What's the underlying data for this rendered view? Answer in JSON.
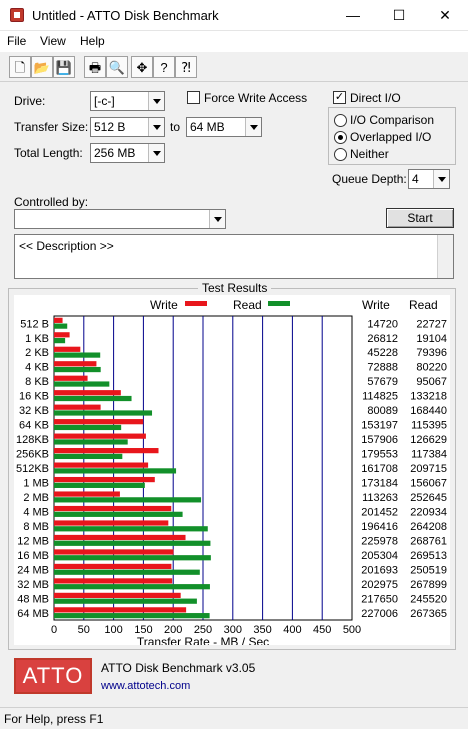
{
  "window": {
    "title": "Untitled - ATTO Disk Benchmark",
    "min_glyph": "—",
    "max_glyph": "☐",
    "close_glyph": "✕"
  },
  "menu": [
    "File",
    "View",
    "Help"
  ],
  "toolbar": {
    "icons": [
      "new-icon",
      "open-icon",
      "save-icon",
      "print-icon",
      "print-preview-icon",
      "move-icon",
      "help-icon",
      "context-help-icon"
    ],
    "glyphs": [
      "🗋",
      "📂",
      "💾",
      "🖶",
      "🔍",
      "✥",
      "?",
      "⁈"
    ]
  },
  "settings": {
    "drive_label": "Drive:",
    "drive_value": "[-c-]",
    "transfer_size_label": "Transfer Size:",
    "transfer_from": "512 B",
    "to_label": "to",
    "transfer_to": "64 MB",
    "total_length_label": "Total Length:",
    "total_length_value": "256 MB",
    "force_write_label": "Force Write Access",
    "force_write_checked": false,
    "direct_io_label": "Direct I/O",
    "direct_io_checked": true,
    "direct_io_mark": "✓",
    "io_comparison_label": "I/O Comparison",
    "overlapped_io_label": "Overlapped I/O",
    "neither_label": "Neither",
    "selected_io_mode": "Overlapped I/O",
    "queue_depth_label": "Queue Depth:",
    "queue_depth_value": "4",
    "controlled_by_label": "Controlled by:",
    "controlled_by_value": "",
    "start_label": "Start",
    "description": "<< Description >>"
  },
  "results": {
    "title": "Test Results",
    "write_legend": "Write",
    "read_legend": "Read",
    "write_header": "Write",
    "read_header": "Read"
  },
  "chart_data": {
    "type": "bar",
    "orientation": "horizontal",
    "categories": [
      "512 B",
      "1 KB",
      "2 KB",
      "4 KB",
      "8 KB",
      "16 KB",
      "32 KB",
      "64 KB",
      "128KB",
      "256KB",
      "512KB",
      "1 MB",
      "2 MB",
      "4 MB",
      "8 MB",
      "12 MB",
      "16 MB",
      "24 MB",
      "32 MB",
      "48 MB",
      "64 MB"
    ],
    "series": [
      {
        "name": "Write",
        "color": "#e8161c",
        "values": [
          14720,
          26812,
          45228,
          72888,
          57679,
          114825,
          80089,
          153197,
          157906,
          179553,
          161708,
          173184,
          113263,
          201452,
          196416,
          225978,
          205304,
          201693,
          202975,
          217650,
          227006
        ]
      },
      {
        "name": "Read",
        "color": "#12902a",
        "values": [
          22727,
          19104,
          79396,
          80220,
          95067,
          133218,
          168440,
          115395,
          126629,
          117384,
          209715,
          156067,
          252645,
          220934,
          264208,
          268761,
          269513,
          250519,
          267899,
          245520,
          267365
        ]
      }
    ],
    "xlabel": "Transfer Rate - MB / Sec",
    "xlim": [
      0,
      500
    ],
    "xticks": [
      0,
      50,
      100,
      150,
      200,
      250,
      300,
      350,
      400,
      450,
      500
    ],
    "grid": true,
    "legend_placement": "top"
  },
  "footer": {
    "logo": "ATTO",
    "product": "ATTO Disk Benchmark v3.05",
    "url": "www.attotech.com"
  },
  "status": "For Help, press F1"
}
